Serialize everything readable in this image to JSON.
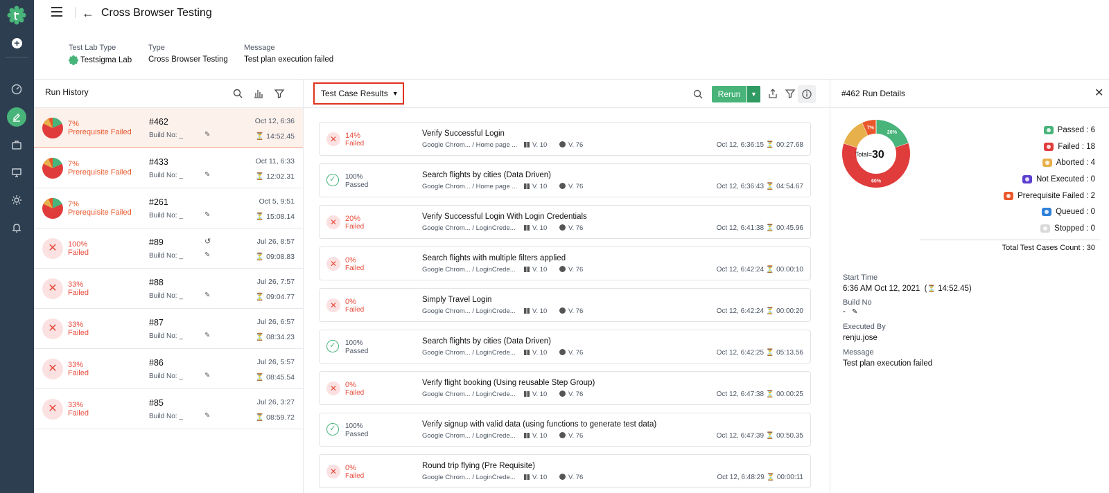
{
  "header": {
    "title": "Cross Browser Testing"
  },
  "meta": [
    {
      "label": "Test Lab Type",
      "value": "Testsigma Lab"
    },
    {
      "label": "Type",
      "value": "Cross Browser Testing"
    },
    {
      "label": "Message",
      "value": "Test plan execution failed"
    }
  ],
  "run_history": {
    "title": "Run History",
    "rows": [
      {
        "pct": "7%",
        "status": "Prerequisite Failed",
        "id": "#462",
        "build": "Build No: _",
        "date": "Oct 12, 6:36",
        "duration": "14:52.45",
        "kind": "prereq",
        "selected": true
      },
      {
        "pct": "7%",
        "status": "Prerequisite Failed",
        "id": "#433",
        "build": "Build No: _",
        "date": "Oct 11, 6:33",
        "duration": "12:02.31",
        "kind": "prereq"
      },
      {
        "pct": "7%",
        "status": "Prerequisite Failed",
        "id": "#261",
        "build": "Build No: _",
        "date": "Oct 5, 9:51",
        "duration": "15:08.14",
        "kind": "prereq"
      },
      {
        "pct": "100%",
        "status": "Failed",
        "id": "#89",
        "build": "Build No: _",
        "date": "Jul 26, 8:57",
        "duration": "09:08.83",
        "kind": "fail",
        "rerun": true
      },
      {
        "pct": "33%",
        "status": "Failed",
        "id": "#88",
        "build": "Build No: _",
        "date": "Jul 26, 7:57",
        "duration": "09:04.77",
        "kind": "fail"
      },
      {
        "pct": "33%",
        "status": "Failed",
        "id": "#87",
        "build": "Build No: _",
        "date": "Jul 26, 6:57",
        "duration": "08:34.23",
        "kind": "fail"
      },
      {
        "pct": "33%",
        "status": "Failed",
        "id": "#86",
        "build": "Build No: _",
        "date": "Jul 26, 5:57",
        "duration": "08:45.54",
        "kind": "fail"
      },
      {
        "pct": "33%",
        "status": "Failed",
        "id": "#85",
        "build": "Build No: _",
        "date": "Jul 26, 3:27",
        "duration": "08:59.72",
        "kind": "fail"
      }
    ]
  },
  "results": {
    "dropdown_label": "Test Case Results",
    "rerun_label": "Rerun",
    "cases": [
      {
        "pct": "14%",
        "status": "Failed",
        "name": "Verify Successful Login",
        "browser": "Google Chrom...  /  Home page ...",
        "os": "V. 10",
        "bv": "V. 76",
        "time": "Oct 12, 6:36:15",
        "duration": "00:27.68",
        "pass": false
      },
      {
        "pct": "100%",
        "status": "Passed",
        "name": "Search flights by cities (Data Driven)",
        "browser": "Google Chrom...  /  Home page ...",
        "os": "V. 10",
        "bv": "V. 76",
        "time": "Oct 12, 6:36:43",
        "duration": "04:54.67",
        "pass": true
      },
      {
        "pct": "20%",
        "status": "Failed",
        "name": "Verify Successful Login With Login Credentials",
        "browser": "Google Chrom...  /  LoginCrede...",
        "os": "V. 10",
        "bv": "V. 76",
        "time": "Oct 12, 6:41:38",
        "duration": "00:45.96",
        "pass": false
      },
      {
        "pct": "0%",
        "status": "Failed",
        "name": "Search flights with multiple filters applied",
        "browser": "Google Chrom...  /  LoginCrede...",
        "os": "V. 10",
        "bv": "V. 76",
        "time": "Oct 12, 6:42:24",
        "duration": "00:00:10",
        "pass": false
      },
      {
        "pct": "0%",
        "status": "Failed",
        "name": "Simply Travel Login",
        "browser": "Google Chrom...  /  LoginCrede...",
        "os": "V. 10",
        "bv": "V. 76",
        "time": "Oct 12, 6:42:24",
        "duration": "00:00:20",
        "pass": false
      },
      {
        "pct": "100%",
        "status": "Passed",
        "name": "Search flights by cities (Data Driven)",
        "browser": "Google Chrom...  /  LoginCrede...",
        "os": "V. 10",
        "bv": "V. 76",
        "time": "Oct 12, 6:42:25",
        "duration": "05:13.56",
        "pass": true
      },
      {
        "pct": "0%",
        "status": "Failed",
        "name": "Verify flight booking (Using reusable Step Group)",
        "browser": "Google Chrom...  /  LoginCrede...",
        "os": "V. 10",
        "bv": "V. 76",
        "time": "Oct 12, 6:47:38",
        "duration": "00:00:25",
        "pass": false
      },
      {
        "pct": "100%",
        "status": "Passed",
        "name": "Verify signup with valid data (using functions to generate test data)",
        "browser": "Google Chrom...  /  LoginCrede...",
        "os": "V. 10",
        "bv": "V. 76",
        "time": "Oct 12, 6:47:39",
        "duration": "00:50.35",
        "pass": true
      },
      {
        "pct": "0%",
        "status": "Failed",
        "name": "Round trip flying (Pre Requisite)",
        "browser": "Google Chrom...  /  LoginCrede...",
        "os": "V. 10",
        "bv": "V. 76",
        "time": "Oct 12, 6:48:29",
        "duration": "00:00:11",
        "pass": false
      }
    ]
  },
  "run_details": {
    "title": "#462 Run Details",
    "total_label": "Total=",
    "total_value": "30",
    "donut": [
      {
        "label": "20%",
        "value": 6,
        "color": "#48b47a"
      },
      {
        "label": "60%",
        "value": 18,
        "color": "#e03c3c"
      },
      {
        "label": "",
        "value": 4,
        "color": "#e8b04a"
      },
      {
        "label": "7%",
        "value": 2,
        "color": "#e9572a"
      }
    ],
    "legend": [
      {
        "text": "Passed : 6",
        "color": "#48b47a"
      },
      {
        "text": "Failed : 18",
        "color": "#e03c3c"
      },
      {
        "text": "Aborted : 4",
        "color": "#e8b04a"
      },
      {
        "text": "Not Executed : 0",
        "color": "#5b3fd1"
      },
      {
        "text": "Prerequisite Failed : 2",
        "color": "#e9572a"
      },
      {
        "text": "Queued : 0",
        "color": "#2f80d8"
      },
      {
        "text": "Stopped : 0",
        "color": "#d9d9d9"
      }
    ],
    "total_count": "Total Test Cases Count : 30",
    "start_time_label": "Start Time",
    "start_time": "6:36 AM Oct 12, 2021",
    "start_duration": "14:52.45)",
    "build_label": "Build No",
    "build_value": "-",
    "executed_by_label": "Executed By",
    "executed_by": "renju.jose",
    "message_label": "Message",
    "message": "Test plan execution failed"
  }
}
